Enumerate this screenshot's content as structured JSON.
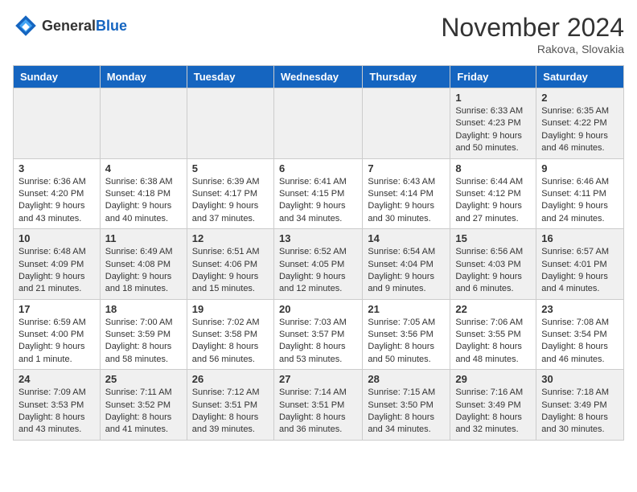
{
  "logo": {
    "text_general": "General",
    "text_blue": "Blue"
  },
  "header": {
    "month": "November 2024",
    "location": "Rakova, Slovakia"
  },
  "weekdays": [
    "Sunday",
    "Monday",
    "Tuesday",
    "Wednesday",
    "Thursday",
    "Friday",
    "Saturday"
  ],
  "weeks": [
    [
      {
        "day": "",
        "info": ""
      },
      {
        "day": "",
        "info": ""
      },
      {
        "day": "",
        "info": ""
      },
      {
        "day": "",
        "info": ""
      },
      {
        "day": "",
        "info": ""
      },
      {
        "day": "1",
        "info": "Sunrise: 6:33 AM\nSunset: 4:23 PM\nDaylight: 9 hours and 50 minutes."
      },
      {
        "day": "2",
        "info": "Sunrise: 6:35 AM\nSunset: 4:22 PM\nDaylight: 9 hours and 46 minutes."
      }
    ],
    [
      {
        "day": "3",
        "info": "Sunrise: 6:36 AM\nSunset: 4:20 PM\nDaylight: 9 hours and 43 minutes."
      },
      {
        "day": "4",
        "info": "Sunrise: 6:38 AM\nSunset: 4:18 PM\nDaylight: 9 hours and 40 minutes."
      },
      {
        "day": "5",
        "info": "Sunrise: 6:39 AM\nSunset: 4:17 PM\nDaylight: 9 hours and 37 minutes."
      },
      {
        "day": "6",
        "info": "Sunrise: 6:41 AM\nSunset: 4:15 PM\nDaylight: 9 hours and 34 minutes."
      },
      {
        "day": "7",
        "info": "Sunrise: 6:43 AM\nSunset: 4:14 PM\nDaylight: 9 hours and 30 minutes."
      },
      {
        "day": "8",
        "info": "Sunrise: 6:44 AM\nSunset: 4:12 PM\nDaylight: 9 hours and 27 minutes."
      },
      {
        "day": "9",
        "info": "Sunrise: 6:46 AM\nSunset: 4:11 PM\nDaylight: 9 hours and 24 minutes."
      }
    ],
    [
      {
        "day": "10",
        "info": "Sunrise: 6:48 AM\nSunset: 4:09 PM\nDaylight: 9 hours and 21 minutes."
      },
      {
        "day": "11",
        "info": "Sunrise: 6:49 AM\nSunset: 4:08 PM\nDaylight: 9 hours and 18 minutes."
      },
      {
        "day": "12",
        "info": "Sunrise: 6:51 AM\nSunset: 4:06 PM\nDaylight: 9 hours and 15 minutes."
      },
      {
        "day": "13",
        "info": "Sunrise: 6:52 AM\nSunset: 4:05 PM\nDaylight: 9 hours and 12 minutes."
      },
      {
        "day": "14",
        "info": "Sunrise: 6:54 AM\nSunset: 4:04 PM\nDaylight: 9 hours and 9 minutes."
      },
      {
        "day": "15",
        "info": "Sunrise: 6:56 AM\nSunset: 4:03 PM\nDaylight: 9 hours and 6 minutes."
      },
      {
        "day": "16",
        "info": "Sunrise: 6:57 AM\nSunset: 4:01 PM\nDaylight: 9 hours and 4 minutes."
      }
    ],
    [
      {
        "day": "17",
        "info": "Sunrise: 6:59 AM\nSunset: 4:00 PM\nDaylight: 9 hours and 1 minute."
      },
      {
        "day": "18",
        "info": "Sunrise: 7:00 AM\nSunset: 3:59 PM\nDaylight: 8 hours and 58 minutes."
      },
      {
        "day": "19",
        "info": "Sunrise: 7:02 AM\nSunset: 3:58 PM\nDaylight: 8 hours and 56 minutes."
      },
      {
        "day": "20",
        "info": "Sunrise: 7:03 AM\nSunset: 3:57 PM\nDaylight: 8 hours and 53 minutes."
      },
      {
        "day": "21",
        "info": "Sunrise: 7:05 AM\nSunset: 3:56 PM\nDaylight: 8 hours and 50 minutes."
      },
      {
        "day": "22",
        "info": "Sunrise: 7:06 AM\nSunset: 3:55 PM\nDaylight: 8 hours and 48 minutes."
      },
      {
        "day": "23",
        "info": "Sunrise: 7:08 AM\nSunset: 3:54 PM\nDaylight: 8 hours and 46 minutes."
      }
    ],
    [
      {
        "day": "24",
        "info": "Sunrise: 7:09 AM\nSunset: 3:53 PM\nDaylight: 8 hours and 43 minutes."
      },
      {
        "day": "25",
        "info": "Sunrise: 7:11 AM\nSunset: 3:52 PM\nDaylight: 8 hours and 41 minutes."
      },
      {
        "day": "26",
        "info": "Sunrise: 7:12 AM\nSunset: 3:51 PM\nDaylight: 8 hours and 39 minutes."
      },
      {
        "day": "27",
        "info": "Sunrise: 7:14 AM\nSunset: 3:51 PM\nDaylight: 8 hours and 36 minutes."
      },
      {
        "day": "28",
        "info": "Sunrise: 7:15 AM\nSunset: 3:50 PM\nDaylight: 8 hours and 34 minutes."
      },
      {
        "day": "29",
        "info": "Sunrise: 7:16 AM\nSunset: 3:49 PM\nDaylight: 8 hours and 32 minutes."
      },
      {
        "day": "30",
        "info": "Sunrise: 7:18 AM\nSunset: 3:49 PM\nDaylight: 8 hours and 30 minutes."
      }
    ]
  ]
}
